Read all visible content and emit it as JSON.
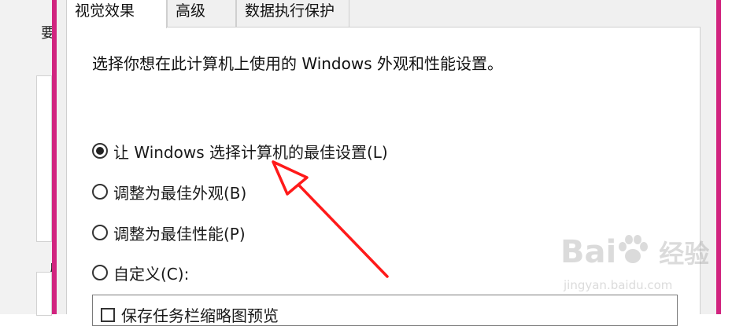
{
  "background_window": {
    "partial_char_top": "要",
    "partial_char_bottom": "丿"
  },
  "dialog": {
    "tabs": [
      {
        "label": "视觉效果",
        "active": true
      },
      {
        "label": "高级",
        "active": false
      },
      {
        "label": "数据执行保护",
        "active": false
      }
    ],
    "description": "选择你想在此计算机上使用的 Windows 外观和性能设置。",
    "options": [
      {
        "label": "让 Windows 选择计算机的最佳设置(L)",
        "selected": true
      },
      {
        "label": "调整为最佳外观(B)",
        "selected": false
      },
      {
        "label": "调整为最佳性能(P)",
        "selected": false
      },
      {
        "label": "自定义(C):",
        "selected": false
      }
    ],
    "effects_list": {
      "first_item": "保存任务栏缩略图预览",
      "first_item_checked": false
    }
  },
  "annotation": {
    "arrow_color": "#ff1a1a"
  },
  "watermark": {
    "brand_latin": "Bai",
    "brand_cn": "经验",
    "url": "jingyan.baidu.com"
  },
  "colors": {
    "window_border": "#d1247f",
    "dialog_bg": "#f0f0f0",
    "panel_bg": "#ffffff"
  }
}
